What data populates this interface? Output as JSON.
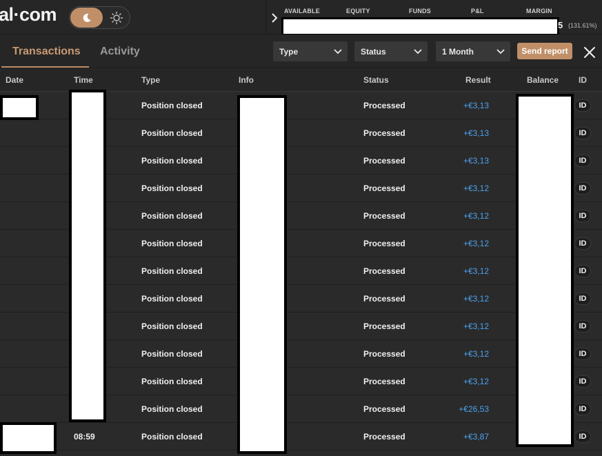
{
  "header": {
    "logo_text": "al·com",
    "stats": [
      "AVAILABLE",
      "EQUITY",
      "FUNDS",
      "P&L",
      "MARGIN"
    ],
    "margin_value_tail": "5",
    "margin_pct": "(131.61%)"
  },
  "tabs": {
    "transactions": "Transactions",
    "activity": "Activity"
  },
  "filters": {
    "type": "Type",
    "status": "Status",
    "period": "1 Month"
  },
  "actions": {
    "send_report": "Send report"
  },
  "table": {
    "columns": [
      "Date",
      "Time",
      "Type",
      "Info",
      "Status",
      "Result",
      "Balance",
      "ID"
    ],
    "rows": [
      {
        "time": "",
        "type": "Position closed",
        "status": "Processed",
        "result": "+€3,13",
        "id": "ID"
      },
      {
        "time": "",
        "type": "Position closed",
        "status": "Processed",
        "result": "+€3,13",
        "id": "ID"
      },
      {
        "time": "",
        "type": "Position closed",
        "status": "Processed",
        "result": "+€3,13",
        "id": "ID"
      },
      {
        "time": "",
        "type": "Position closed",
        "status": "Processed",
        "result": "+€3,12",
        "id": "ID"
      },
      {
        "time": "",
        "type": "Position closed",
        "status": "Processed",
        "result": "+€3,12",
        "id": "ID"
      },
      {
        "time": "",
        "type": "Position closed",
        "status": "Processed",
        "result": "+€3,12",
        "id": "ID"
      },
      {
        "time": "",
        "type": "Position closed",
        "status": "Processed",
        "result": "+€3,12",
        "id": "ID"
      },
      {
        "time": "",
        "type": "Position closed",
        "status": "Processed",
        "result": "+€3,12",
        "id": "ID"
      },
      {
        "time": "",
        "type": "Position closed",
        "status": "Processed",
        "result": "+€3,12",
        "id": "ID"
      },
      {
        "time": "",
        "type": "Position closed",
        "status": "Processed",
        "result": "+€3,12",
        "id": "ID"
      },
      {
        "time": "",
        "type": "Position closed",
        "status": "Processed",
        "result": "+€3,12",
        "id": "ID"
      },
      {
        "time": "",
        "type": "Position closed",
        "status": "Processed",
        "result": "+€26,53",
        "id": "ID"
      },
      {
        "time": "08:59",
        "type": "Position closed",
        "status": "Processed",
        "result": "+€3,87",
        "id": "ID"
      }
    ]
  },
  "colors": {
    "accent": "#c08f68",
    "result_positive": "#4da3f0",
    "background": "#2a2a2a"
  }
}
